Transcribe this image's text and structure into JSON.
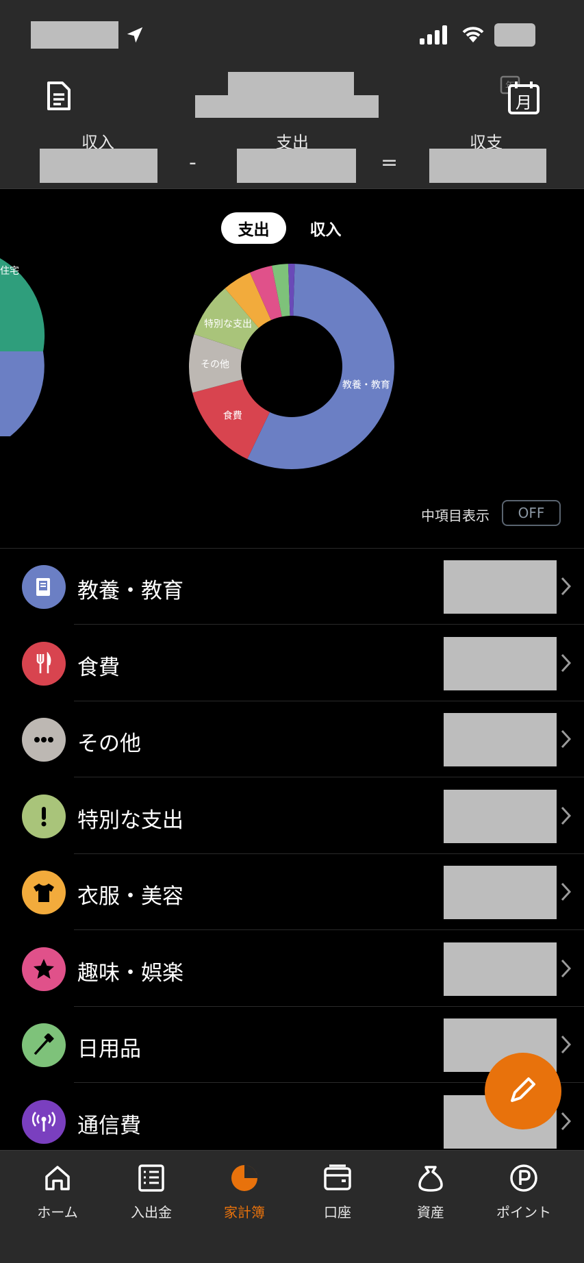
{
  "header": {
    "income_label": "収入",
    "expense_label": "支出",
    "balance_label": "収支",
    "minus": "-",
    "equals": "="
  },
  "chart": {
    "tabs": [
      {
        "label": "支出",
        "active": true
      },
      {
        "label": "収入",
        "active": false
      }
    ],
    "side_chart_label": "住宅",
    "toggle_label": "中項目表示",
    "toggle_value": "OFF"
  },
  "chart_data": {
    "type": "pie",
    "donut": true,
    "slices": [
      {
        "label": "教養・教育",
        "value": 55.5,
        "color": "#6b7fc4"
      },
      {
        "label": "食費",
        "value": 13.5,
        "color": "#d8444f"
      },
      {
        "label": "その他",
        "value": 9.0,
        "color": "#bdb8b3"
      },
      {
        "label": "特別な支出",
        "value": 8.5,
        "color": "#a9c47a"
      },
      {
        "label": "",
        "value": 4.5,
        "color": "#f2ab3c"
      },
      {
        "label": "",
        "value": 3.5,
        "color": "#e0518a"
      },
      {
        "label": "",
        "value": 2.5,
        "color": "#7ec27a"
      },
      {
        "label": "",
        "value": 1.0,
        "color": "#6a4ab8"
      }
    ]
  },
  "categories": [
    {
      "label": "教養・教育",
      "icon": "book-icon",
      "color": "#6b7fc4"
    },
    {
      "label": "食費",
      "icon": "fork-knife-icon",
      "color": "#d8444f"
    },
    {
      "label": "その他",
      "icon": "more-dots-icon",
      "color": "#bdb8b3"
    },
    {
      "label": "特別な支出",
      "icon": "exclamation-icon",
      "color": "#a9c47a"
    },
    {
      "label": "衣服・美容",
      "icon": "shirt-icon",
      "color": "#f2ab3c"
    },
    {
      "label": "趣味・娯楽",
      "icon": "star-icon",
      "color": "#e0518a"
    },
    {
      "label": "日用品",
      "icon": "toothbrush-icon",
      "color": "#7ec27a"
    },
    {
      "label": "通信費",
      "icon": "antenna-icon",
      "color": "#7a3fbf"
    }
  ],
  "nav": [
    {
      "label": "ホーム",
      "icon": "home-icon",
      "active": false
    },
    {
      "label": "入出金",
      "icon": "list-icon",
      "active": false
    },
    {
      "label": "家計簿",
      "icon": "pie-chart-icon",
      "active": true
    },
    {
      "label": "口座",
      "icon": "wallet-icon",
      "active": false
    },
    {
      "label": "資産",
      "icon": "money-bag-icon",
      "active": false
    },
    {
      "label": "ポイント",
      "icon": "point-icon",
      "active": false
    }
  ],
  "colors": {
    "accent": "#e8720c",
    "background": "#000000",
    "header_bg": "#2a2a2a"
  }
}
